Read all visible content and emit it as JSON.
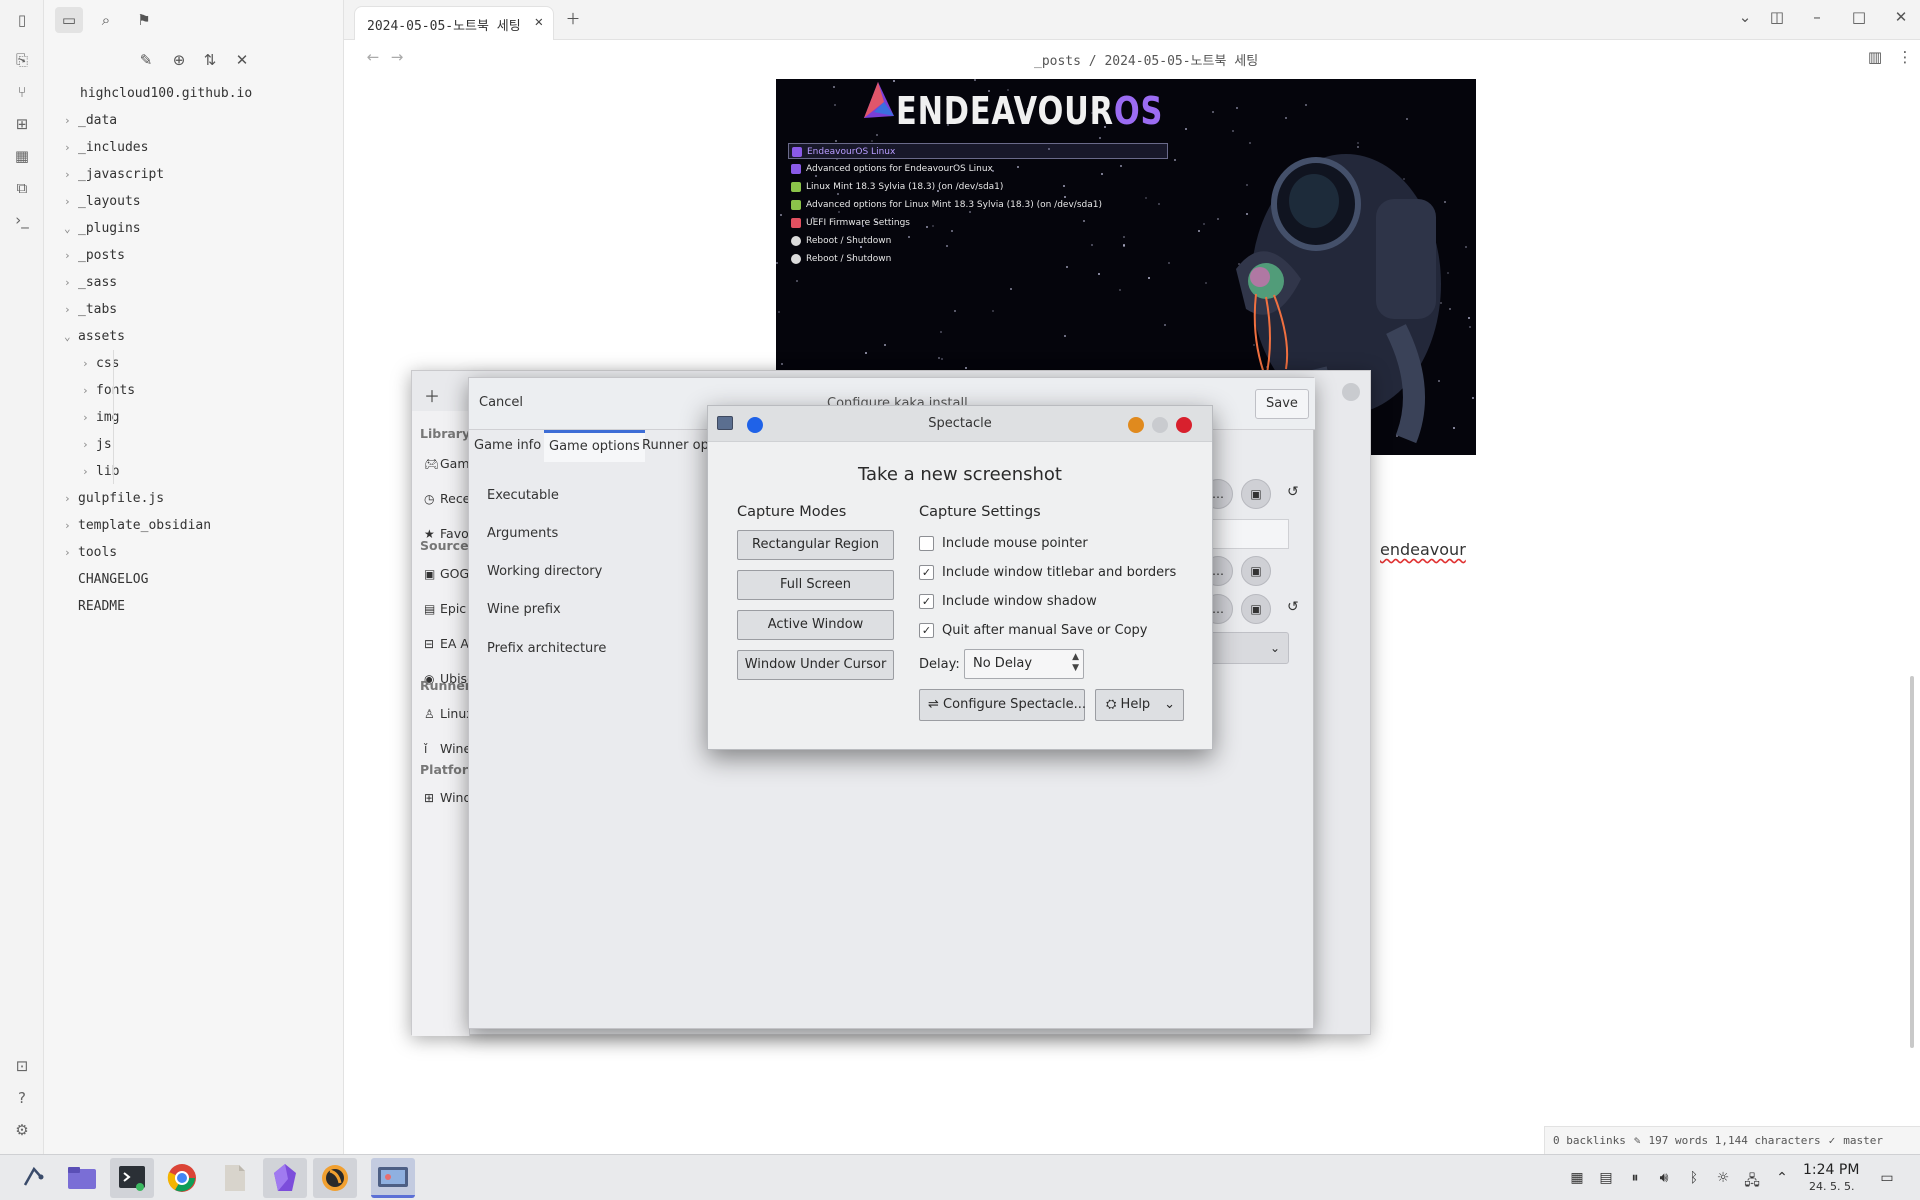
{
  "app": {
    "vault_name": "highcloud100.github.io",
    "tab_title": "2024-05-05-노트북 세팅",
    "breadcrumb": {
      "folder": "_posts",
      "sep": "/",
      "file": "2024-05-05-노트북 세팅"
    }
  },
  "file_tree": [
    {
      "label": "_data",
      "type": "folder",
      "expanded": false,
      "depth": 0
    },
    {
      "label": "_includes",
      "type": "folder",
      "expanded": false,
      "depth": 0
    },
    {
      "label": "_javascript",
      "type": "folder",
      "expanded": false,
      "depth": 0
    },
    {
      "label": "_layouts",
      "type": "folder",
      "expanded": false,
      "depth": 0
    },
    {
      "label": "_plugins",
      "type": "folder",
      "expanded": true,
      "depth": 0
    },
    {
      "label": "_posts",
      "type": "folder",
      "expanded": false,
      "depth": 0
    },
    {
      "label": "_sass",
      "type": "folder",
      "expanded": false,
      "depth": 0
    },
    {
      "label": "_tabs",
      "type": "folder",
      "expanded": false,
      "depth": 0
    },
    {
      "label": "assets",
      "type": "folder",
      "expanded": true,
      "depth": 0
    },
    {
      "label": "css",
      "type": "folder",
      "expanded": false,
      "depth": 1
    },
    {
      "label": "fonts",
      "type": "folder",
      "expanded": false,
      "depth": 1
    },
    {
      "label": "img",
      "type": "folder",
      "expanded": false,
      "depth": 1
    },
    {
      "label": "js",
      "type": "folder",
      "expanded": false,
      "depth": 1
    },
    {
      "label": "lib",
      "type": "folder",
      "expanded": false,
      "depth": 1
    },
    {
      "label": "gulpfile.js",
      "type": "folder",
      "expanded": false,
      "depth": 0
    },
    {
      "label": "template_obsidian",
      "type": "folder",
      "expanded": false,
      "depth": 0
    },
    {
      "label": "tools",
      "type": "folder",
      "expanded": false,
      "depth": 0
    },
    {
      "label": "CHANGELOG",
      "type": "file",
      "depth": 0
    },
    {
      "label": "README",
      "type": "file",
      "depth": 0
    }
  ],
  "boot_menu": {
    "logo_main": "ENDEAVOUR",
    "logo_suffix": "OS",
    "items": [
      {
        "label": "EndeavourOS Linux",
        "icon": "endeavour-icon",
        "selected": true
      },
      {
        "label": "Advanced options for EndeavourOS Linux",
        "icon": "endeavour-icon",
        "selected": false
      },
      {
        "label": "Linux Mint 18.3 Sylvia (18.3) (on /dev/sda1)",
        "icon": "mint-icon",
        "selected": false
      },
      {
        "label": "Advanced options for Linux Mint 18.3 Sylvia (18.3) (on /dev/sda1)",
        "icon": "mint-icon",
        "selected": false
      },
      {
        "label": "UEFI Firmware Settings",
        "icon": "uefi-icon",
        "selected": false
      },
      {
        "label": "Reboot / Shutdown",
        "icon": "power-icon",
        "selected": false
      },
      {
        "label": "Reboot / Shutdown",
        "icon": "power-icon",
        "selected": false
      }
    ]
  },
  "editor": {
    "visible_word": "endeavour"
  },
  "status_bar": {
    "backlinks": "0 backlinks",
    "counts": "197 words 1,144 characters",
    "branch": "master"
  },
  "lutris": {
    "sidebar": {
      "library_header": "Library",
      "library_items": [
        {
          "label": "Games",
          "icon": "gamepad-icon"
        },
        {
          "label": "Recent",
          "icon": "clock-icon"
        },
        {
          "label": "Favorites",
          "icon": "star-icon"
        }
      ],
      "sources_header": "Sources",
      "source_items": [
        {
          "label": "GOG",
          "icon": "gog-icon"
        },
        {
          "label": "Epic",
          "icon": "epic-icon"
        },
        {
          "label": "EA App",
          "icon": "ea-icon"
        },
        {
          "label": "Ubisoft",
          "icon": "ubisoft-icon"
        }
      ],
      "runners_header": "Runners",
      "runner_items": [
        {
          "label": "Linux",
          "icon": "linux-icon"
        },
        {
          "label": "Wine",
          "icon": "wine-icon"
        }
      ],
      "platforms_header": "Platforms",
      "platform_items": [
        {
          "label": "Windows",
          "icon": "windows-icon"
        }
      ]
    }
  },
  "configure_dialog": {
    "cancel_label": "Cancel",
    "title": "Configure kaka install",
    "save_label": "Save",
    "tabs": [
      {
        "label": "Game info",
        "active": false
      },
      {
        "label": "Game options",
        "active": true
      },
      {
        "label": "Runner options",
        "active": false
      }
    ],
    "rows": [
      "Executable",
      "Arguments",
      "Working directory",
      "Wine prefix",
      "Prefix architecture"
    ]
  },
  "spectacle": {
    "title": "Spectacle",
    "heading": "Take a new screenshot",
    "capture_modes_label": "Capture Modes",
    "capture_settings_label": "Capture Settings",
    "modes": [
      "Rectangular Region",
      "Full Screen",
      "Active Window",
      "Window Under Cursor"
    ],
    "settings": [
      {
        "label": "Include mouse pointer",
        "checked": false
      },
      {
        "label": "Include window titlebar and borders",
        "checked": true
      },
      {
        "label": "Include window shadow",
        "checked": true
      },
      {
        "label": "Quit after manual Save or Copy",
        "checked": true
      }
    ],
    "delay_label": "Delay:",
    "delay_value": "No Delay",
    "configure_label": "Configure Spectacle...",
    "help_label": "Help",
    "colors": {
      "blue": "#1f62e8",
      "orange": "#e08a1e",
      "grey": "#c9cbcf",
      "red": "#d8202d"
    }
  },
  "taskbar": {
    "apps": [
      {
        "name": "app-launcher",
        "icon": "launcher-icon"
      },
      {
        "name": "file-manager",
        "icon": "folder-icon"
      },
      {
        "name": "terminal",
        "icon": "terminal-icon"
      },
      {
        "name": "chrome",
        "icon": "chrome-icon"
      },
      {
        "name": "files",
        "icon": "file-icon"
      },
      {
        "name": "obsidian",
        "icon": "obsidian-icon"
      },
      {
        "name": "lutris",
        "icon": "lutris-icon"
      },
      {
        "name": "spectacle",
        "icon": "spectacle-icon"
      }
    ],
    "clock_time": "1:24 PM",
    "clock_date": "24. 5. 5."
  }
}
